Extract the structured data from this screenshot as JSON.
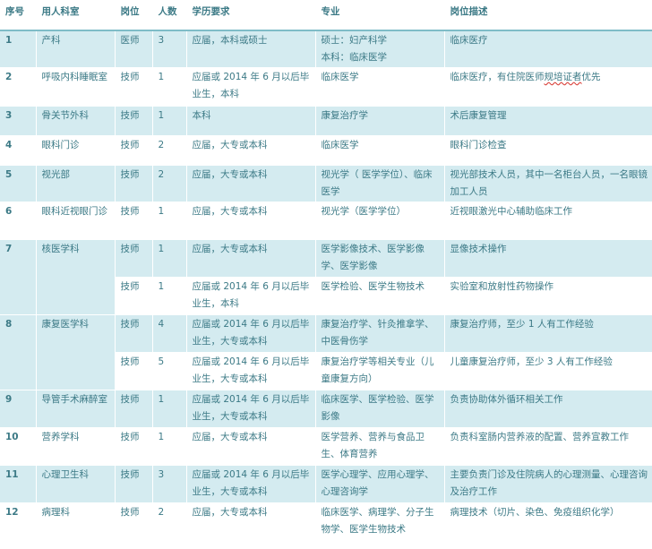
{
  "headers": [
    "序号",
    "用人科室",
    "岗位",
    "人数",
    "学历要求",
    "专业",
    "岗位描述"
  ],
  "rows": [
    {
      "seq": "1",
      "dept": "产科",
      "post": "医师",
      "count": "3",
      "edu": "应届，本科或硕士",
      "major": "硕士：妇产科学\n本科：临床医学",
      "desc": "临床医疗"
    },
    {
      "seq": "2",
      "dept": "呼吸内科睡眠室",
      "post": "技师",
      "count": "1",
      "edu": "应届或 2014 年 6 月以后毕业生，本科",
      "major": "临床医学",
      "desc_a": "临床医疗，有住院医师",
      "desc_b": "规培证者",
      "desc_c": "优先"
    },
    {
      "seq": "3",
      "dept": "骨关节外科",
      "post": "技师",
      "count": "1",
      "edu": "本科",
      "major": "康复治疗学",
      "desc": "术后康复管理"
    },
    {
      "seq": "4",
      "dept": "眼科门诊",
      "post": "技师",
      "count": "2",
      "edu": "应届，大专或本科",
      "major": "临床医学",
      "desc": "眼科门诊检查"
    },
    {
      "seq": "5",
      "dept": "视光部",
      "post": "技师",
      "count": "2",
      "edu": "应届，大专或本科",
      "major": "视光学（ 医学学位）、临床医学",
      "desc": "视光部技术人员，其中一名柜台人员，一名眼镜加工人员"
    },
    {
      "seq": "6",
      "dept": "眼科近视眼门诊",
      "post": "技师",
      "count": "1",
      "edu": "应届，大专或本科",
      "major": "视光学（医学学位）",
      "desc": "近视眼激光中心辅助临床工作"
    },
    {
      "seq": "7",
      "dept": "核医学科",
      "post": "技师",
      "count": "1",
      "edu": "应届，大专或本科",
      "major": "医学影像技术、医学影像学、医学影像",
      "desc": "显像技术操作"
    },
    {
      "post": "技师",
      "count": "1",
      "edu": "应届或 2014 年 6 月以后毕业生，本科",
      "major": "医学检验、医学生物技术",
      "desc": "实验室和放射性药物操作"
    },
    {
      "seq": "8",
      "dept": "康复医学科",
      "post": "技师",
      "count": "4",
      "edu": "应届或 2014 年 6 月以后毕业生，大专或本科",
      "major": "康复治疗学、针灸推拿学、中医骨伤学",
      "desc": "康复治疗师，至少 1 人有工作经验"
    },
    {
      "post": "技师",
      "count": "5",
      "edu": "应届或 2014 年 6 月以后毕业生，大专或本科",
      "major": "康复治疗学等相关专业（儿童康复方向）",
      "desc": "儿童康复治疗师，至少 3 人有工作经验"
    },
    {
      "seq": "9",
      "dept": "导管手术麻醉室",
      "post": "技师",
      "count": "1",
      "edu": "应届或 2014 年 6 月以后毕业生，大专或本科",
      "major": "临床医学、医学检验、医学影像",
      "desc": "负责协助体外循环相关工作"
    },
    {
      "seq": "10",
      "dept": "营养学科",
      "post": "技师",
      "count": "1",
      "edu": "应届，大专或本科",
      "major": "医学营养、营养与食品卫生、体育营养",
      "desc": "负责科室肠内营养液的配置、营养宣教工作"
    },
    {
      "seq": "11",
      "dept": "心理卫生科",
      "post": "技师",
      "count": "3",
      "edu": "应届或 2014 年 6 月以后毕业生，大专或本科",
      "major": "医学心理学、应用心理学、心理咨询学",
      "desc": "主要负责门诊及住院病人的心理测量、心理咨询及治疗工作"
    },
    {
      "seq": "12",
      "dept": "病理科",
      "post": "技师",
      "count": "2",
      "edu": "应届，大专或本科",
      "major": "临床医学、病理学、分子生物学、医学生物技术",
      "desc": "病理技术（切片、染色、免疫组织化学）"
    }
  ],
  "colors": {
    "text": "#3c7a86",
    "stripe": "#d4ebf0",
    "header_rule": "#7fbcc7",
    "typo_mark": "#d9413a"
  }
}
